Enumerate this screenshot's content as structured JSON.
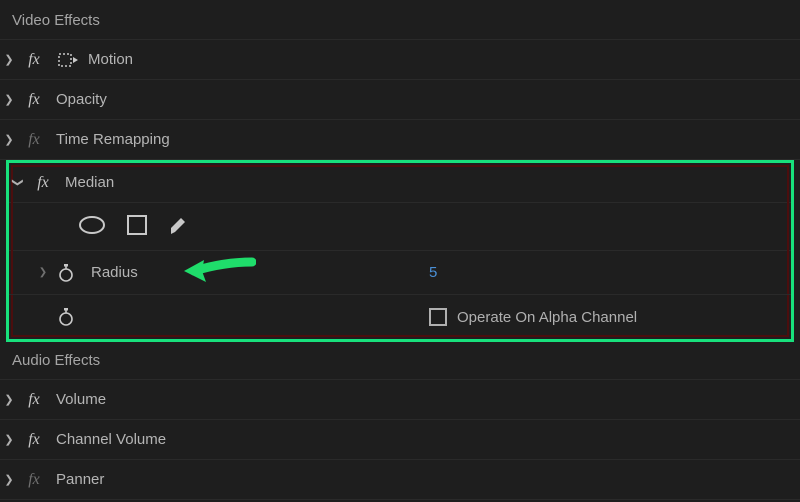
{
  "sections": {
    "video": {
      "title": "Video Effects"
    },
    "audio": {
      "title": "Audio Effects"
    }
  },
  "effects": {
    "motion": {
      "label": "Motion"
    },
    "opacity": {
      "label": "Opacity"
    },
    "timeRemapping": {
      "label": "Time Remapping"
    },
    "median": {
      "label": "Median",
      "radius": {
        "label": "Radius",
        "value": "5"
      },
      "alpha": {
        "label": "Operate On Alpha Channel"
      }
    },
    "volume": {
      "label": "Volume"
    },
    "channelVolume": {
      "label": "Channel Volume"
    },
    "panner": {
      "label": "Panner"
    }
  }
}
